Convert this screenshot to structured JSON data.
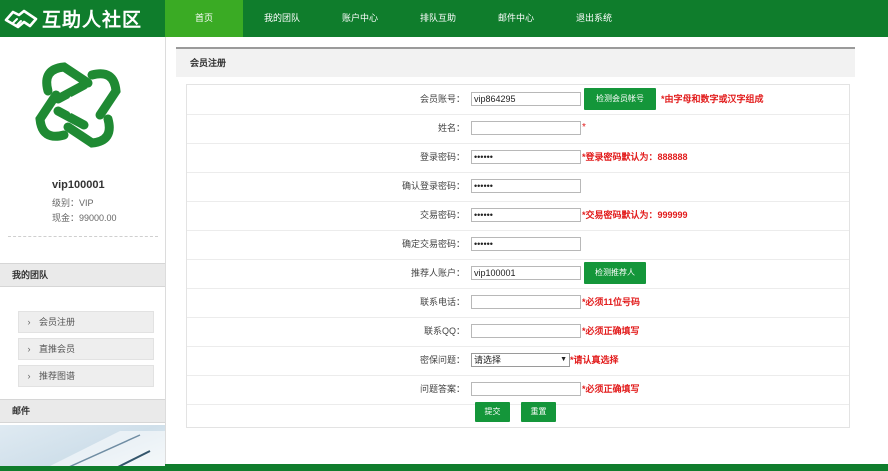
{
  "header": {
    "logo_text": "互助人社区",
    "nav": [
      {
        "label": "首页",
        "active": true
      },
      {
        "label": "我的团队",
        "active": false
      },
      {
        "label": "账户中心",
        "active": false
      },
      {
        "label": "排队互助",
        "active": false
      },
      {
        "label": "邮件中心",
        "active": false
      },
      {
        "label": "退出系统",
        "active": false
      }
    ]
  },
  "sidebar": {
    "username": "vip100001",
    "level": "级别：VIP",
    "balance": "现金：99000.00",
    "team_title": "我的团队",
    "items": [
      {
        "label": "会员注册"
      },
      {
        "label": "直推会员"
      },
      {
        "label": "推荐图谱"
      }
    ],
    "mail_title": "邮件"
  },
  "main": {
    "section_title": "会员注册",
    "form": {
      "rows": [
        {
          "label": "会员账号：",
          "value": "vip864295",
          "button": "检测会员帐号",
          "hint": "*由字母和数字或汉字组成"
        },
        {
          "label": "姓名：",
          "value": "",
          "hint": "*"
        },
        {
          "label": "登录密码：",
          "value": "••••••",
          "hint": "*登录密码默认为：888888"
        },
        {
          "label": "确认登录密码：",
          "value": "••••••",
          "hint": ""
        },
        {
          "label": "交易密码：",
          "value": "••••••",
          "hint": "*交易密码默认为：999999"
        },
        {
          "label": "确定交易密码：",
          "value": "••••••",
          "hint": ""
        },
        {
          "label": "推荐人账户：",
          "value": "vip100001",
          "button": "检测推荐人",
          "hint": ""
        },
        {
          "label": "联系电话：",
          "value": "",
          "hint": "*必须11位号码"
        },
        {
          "label": "联系QQ：",
          "value": "",
          "hint": "*必须正确填写"
        },
        {
          "label": "密保问题：",
          "select": "请选择",
          "hint": "*请认真选择"
        },
        {
          "label": "问题答案：",
          "value": "",
          "hint": "*必须正确填写"
        }
      ],
      "submit_label": "提交",
      "reset_label": "重置"
    }
  },
  "colors": {
    "header_green": "#0f7d2c",
    "active_green": "#3aab24",
    "button_green": "#14963a",
    "hint_red": "#e21b1b"
  },
  "icons": {
    "logo": "handshake-logo-icon",
    "avatar": "green-knot-emblem-icon",
    "chevron": "chevron-right-icon"
  }
}
